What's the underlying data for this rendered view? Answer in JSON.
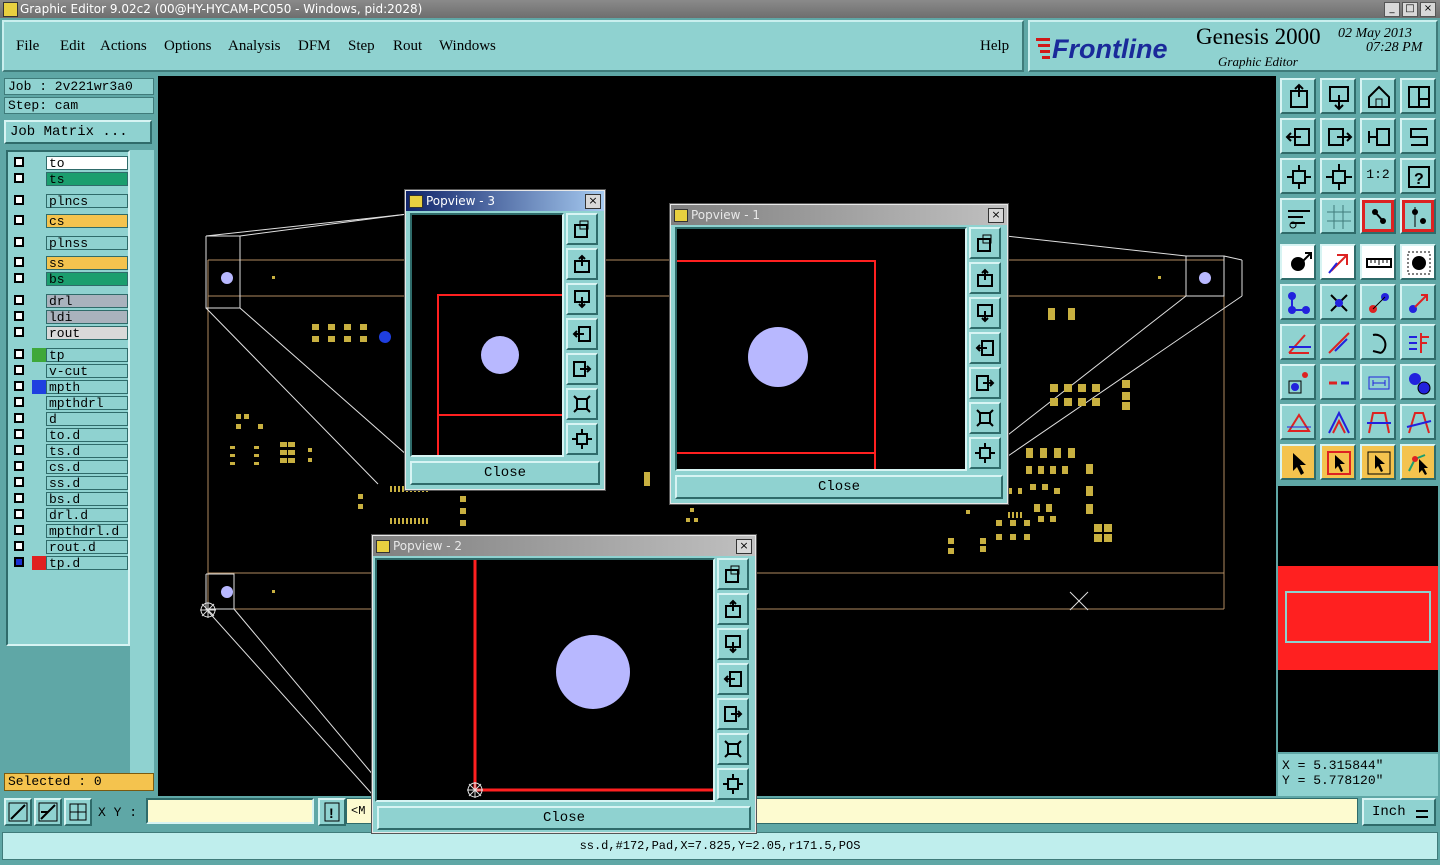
{
  "window": {
    "title": "Graphic Editor 9.02c2 (00@HY-HYCAM-PC050 - Windows, pid:2028)"
  },
  "menu": {
    "items": [
      {
        "label": "File"
      },
      {
        "label": "Edit"
      },
      {
        "label": "Actions"
      },
      {
        "label": "Options"
      },
      {
        "label": "Analysis"
      },
      {
        "label": "DFM"
      },
      {
        "label": "Step"
      },
      {
        "label": "Rout"
      },
      {
        "label": "Windows"
      }
    ],
    "help": "Help"
  },
  "brand": {
    "logo_text": "Frontline",
    "product": "Genesis 2000",
    "date": "02 May 2013",
    "time": "07:28 PM",
    "subtitle": "Graphic Editor"
  },
  "job": {
    "job_line": "Job : 2v221wr3a0",
    "step_line": "Step: cam",
    "matrix_button": "Job Matrix ..."
  },
  "layers": [
    {
      "name": "to",
      "color": "#ffffff",
      "swatch": ""
    },
    {
      "name": "ts",
      "color": "#1b9e6e",
      "swatch": ""
    },
    {
      "name": "plncs",
      "color": "#8fd2d0",
      "swatch": ""
    },
    {
      "name": "cs",
      "color": "#f4c34e",
      "swatch": ""
    },
    {
      "name": "plnss",
      "color": "#8fd2d0",
      "swatch": ""
    },
    {
      "name": "ss",
      "color": "#f4c34e",
      "swatch": ""
    },
    {
      "name": "bs",
      "color": "#1b9e6e",
      "swatch": ""
    },
    {
      "name": "drl",
      "color": "#a9b2bd",
      "swatch": ""
    },
    {
      "name": "ldi",
      "color": "#a9b2bd",
      "swatch": ""
    },
    {
      "name": "rout",
      "color": "#d9d9d9",
      "swatch": ""
    },
    {
      "name": "tp",
      "color": "#8fd2d0",
      "swatch": "#3fa83a"
    },
    {
      "name": "v-cut",
      "color": "#8fd2d0",
      "swatch": ""
    },
    {
      "name": "mpth",
      "color": "#8fd2d0",
      "swatch": "#1f3fe0"
    },
    {
      "name": "mpthdrl",
      "color": "#8fd2d0",
      "swatch": ""
    },
    {
      "name": "d",
      "color": "#8fd2d0",
      "swatch": ""
    },
    {
      "name": "to.d",
      "color": "#8fd2d0",
      "swatch": ""
    },
    {
      "name": "ts.d",
      "color": "#8fd2d0",
      "swatch": ""
    },
    {
      "name": "cs.d",
      "color": "#8fd2d0",
      "swatch": ""
    },
    {
      "name": "ss.d",
      "color": "#8fd2d0",
      "swatch": ""
    },
    {
      "name": "bs.d",
      "color": "#8fd2d0",
      "swatch": ""
    },
    {
      "name": "drl.d",
      "color": "#8fd2d0",
      "swatch": ""
    },
    {
      "name": "mpthdrl.d",
      "color": "#8fd2d0",
      "swatch": ""
    },
    {
      "name": "rout.d",
      "color": "#8fd2d0",
      "swatch": ""
    },
    {
      "name": "tp.d",
      "color": "#8fd2d0",
      "swatch": "#e02020"
    }
  ],
  "selected": "Selected : 0",
  "popviews": [
    {
      "title": "Popview - 3",
      "close_label": "Close"
    },
    {
      "title": "Popview - 1",
      "close_label": "Close"
    },
    {
      "title": "Popview - 2",
      "close_label": "Close"
    }
  ],
  "coords": {
    "x": "X = 5.315844\"",
    "y": "Y = 5.778120\""
  },
  "bottom": {
    "xy_label": "X Y :",
    "xy_value": "",
    "message": "<M",
    "units": "Inch"
  },
  "status": "ss.d,#172,Pad,X=7.825,Y=2.05,r171.5,POS",
  "colors": {
    "panel": "#8fd2d0",
    "frame": "#5fa7a6",
    "pad": "#c8b040",
    "pad_highlight": "#b8b8ff",
    "trace": "#ff2020"
  }
}
